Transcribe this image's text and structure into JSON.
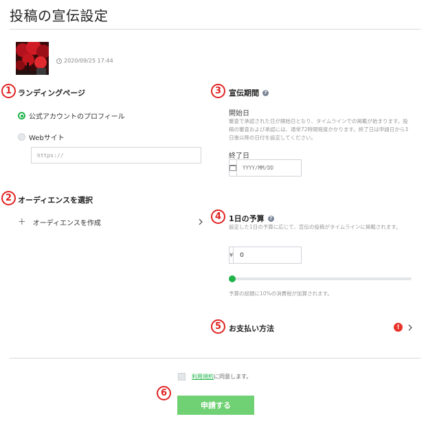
{
  "page": {
    "title": "投稿の宣伝設定"
  },
  "post": {
    "date": "2020/09/25 17:44"
  },
  "markers": [
    "1",
    "2",
    "3",
    "4",
    "5",
    "6"
  ],
  "landing": {
    "heading": "ランディングページ",
    "option_profile": "公式アカウントのプロフィール",
    "option_website": "Webサイト",
    "selected": "公式アカウントのプロフィール",
    "url_placeholder": "https://"
  },
  "audience": {
    "heading": "オーディエンスを選択",
    "create_label": "オーディエンスを作成"
  },
  "period": {
    "heading": "宣伝期間",
    "start_label": "開始日",
    "start_desc": "審査で承認された日が開始日となり、タイムラインでの掲載が始まります。投稿の審査および承認には、通常72時間程度かかります。終了日は申請日から3日後以降の日付を設定してください。",
    "end_label": "終了日",
    "end_placeholder": "YYYY/MM/DD"
  },
  "budget": {
    "heading": "1日の予算",
    "desc": "設定した1日の予算に応じて、宣伝の投稿がタイムラインに掲載されます。",
    "currency": "¥",
    "value": "0",
    "slider_level": 0,
    "tax_note": "予算の総額に10%の消費税が加算されます。"
  },
  "payment": {
    "heading": "お支払い方法",
    "alert": "!"
  },
  "footer": {
    "terms_link": "利用規約",
    "terms_suffix": "に同意します。",
    "submit_label": "申請する"
  },
  "colors": {
    "accent_green": "#1fb34a",
    "button_green": "#6fd173",
    "marker_red": "#e02020",
    "alert_red": "#e8342a"
  }
}
